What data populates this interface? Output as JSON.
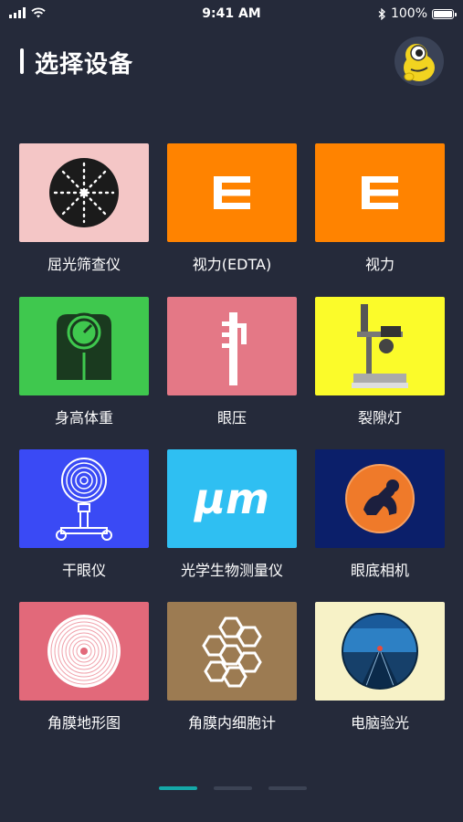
{
  "status_bar": {
    "time": "9:41 AM",
    "battery": "100%",
    "signal_icon": "cellular-signal-icon",
    "wifi_icon": "wifi-icon",
    "bluetooth_icon": "bluetooth-icon",
    "battery_icon": "battery-icon"
  },
  "header": {
    "title": "选择设备",
    "avatar_icon": "cartoon-mascot-avatar-icon"
  },
  "devices": [
    {
      "label": "屈光筛查仪",
      "icon": "refraction-screener-icon",
      "color": "#f4c6c6"
    },
    {
      "label": "视力(EDTA)",
      "icon": "eye-chart-e-icon",
      "color": "#ff8300"
    },
    {
      "label": "视力",
      "icon": "eye-chart-e-icon",
      "color": "#ff8300"
    },
    {
      "label": "身高体重",
      "icon": "height-weight-scale-icon",
      "color": "#3fc84e"
    },
    {
      "label": "眼压",
      "icon": "tonometer-icon",
      "color": "#e47886"
    },
    {
      "label": "裂隙灯",
      "icon": "slit-lamp-icon",
      "color": "#fbfb2a"
    },
    {
      "label": "干眼仪",
      "icon": "dry-eye-analyzer-icon",
      "color": "#3a4af5"
    },
    {
      "label": "光学生物测量仪",
      "icon": "micrometer-um-icon",
      "color": "#2fbff2"
    },
    {
      "label": "眼底相机",
      "icon": "fundus-camera-icon",
      "color": "#0b1f6a"
    },
    {
      "label": "角膜地形图",
      "icon": "corneal-topography-icon",
      "color": "#e2697a"
    },
    {
      "label": "角膜内细胞计",
      "icon": "endothelial-cell-counter-icon",
      "color": "#9c7b52"
    },
    {
      "label": "电脑验光",
      "icon": "auto-refractor-icon",
      "color": "#f7f2c7"
    }
  ],
  "um_text": "μm",
  "pager": {
    "pages": 3,
    "active": 0
  }
}
